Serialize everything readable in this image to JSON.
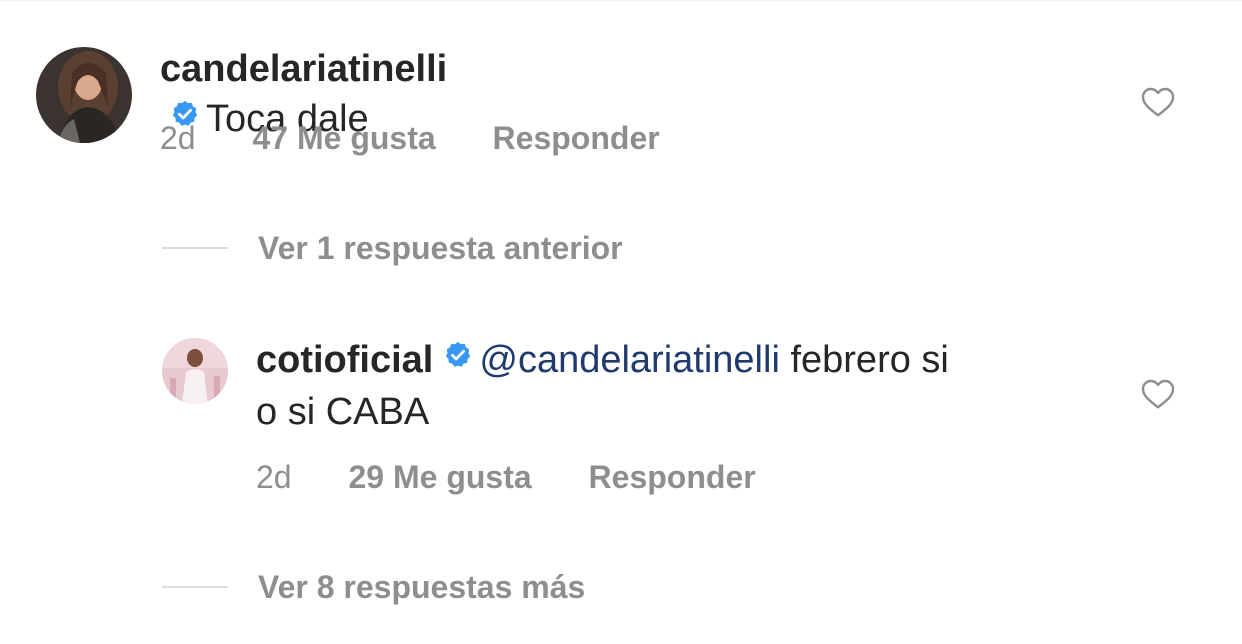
{
  "comments": [
    {
      "username": "candelariatinelli",
      "verified": true,
      "text": "Toca dale",
      "time": "2d",
      "likes": "47 Me gusta",
      "reply": "Responder",
      "avatar_icon": "profile-photo-woman-dark-hair"
    },
    {
      "username": "cotioficial",
      "verified": true,
      "mention": "@candelariatinelli",
      "text_line1": "febrero si",
      "text_line2": "o si CABA",
      "time": "2d",
      "likes": "29 Me gusta",
      "reply": "Responder",
      "avatar_icon": "profile-photo-man-white-suit"
    }
  ],
  "threads": {
    "previous_replies": "Ver 1 respuesta anterior",
    "more_replies": "Ver 8 respuestas más"
  },
  "colors": {
    "text": "#262626",
    "meta": "#8e8e8e",
    "verified_badge": "#3897f0",
    "mention": "#1f3a6e",
    "divider": "#dbdbdb"
  },
  "icons": {
    "like": "heart-outline-icon",
    "verified": "verified-badge-icon"
  }
}
